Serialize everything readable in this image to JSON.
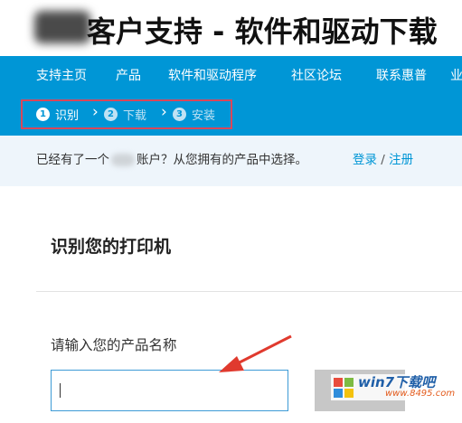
{
  "header": {
    "title": "客户支持 - 软件和驱动下载"
  },
  "nav": {
    "items": [
      {
        "label": "支持主页"
      },
      {
        "label": "产品"
      },
      {
        "label": "软件和驱动程序"
      },
      {
        "label": "社区论坛"
      },
      {
        "label": "联系惠普"
      },
      {
        "label": "业"
      }
    ],
    "active_index": 2
  },
  "steps": [
    {
      "num": "1",
      "label": "识别",
      "state": "active"
    },
    {
      "num": "2",
      "label": "下载",
      "state": "inactive"
    },
    {
      "num": "3",
      "label": "安装",
      "state": "inactive"
    }
  ],
  "account": {
    "text_before": "已经有了一个",
    "text_after": "账户？从您拥有的产品中选择。",
    "login_label": "登录",
    "separator": "/",
    "register_label": "注册"
  },
  "identify": {
    "title": "识别您的打印机",
    "field_label": "请输入您的产品名称",
    "input_value": "",
    "input_placeholder": ""
  },
  "watermark": {
    "main": "win7下载吧",
    "sub": "www.8495.com"
  },
  "colors": {
    "brand_blue": "#0096d6",
    "highlight_red": "#d9475a",
    "arrow_red": "#e03a2e"
  }
}
